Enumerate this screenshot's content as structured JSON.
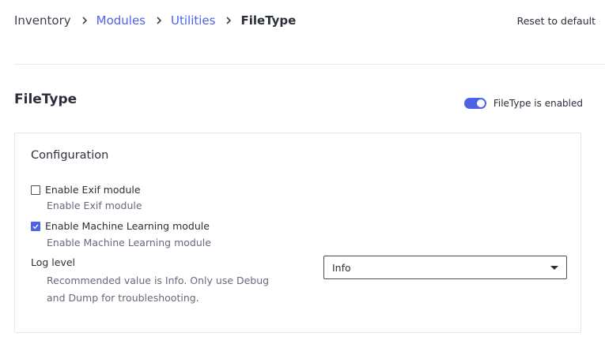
{
  "breadcrumb": {
    "items": [
      {
        "label": "Inventory"
      },
      {
        "label": "Modules"
      },
      {
        "label": "Utilities"
      },
      {
        "label": "FileType"
      }
    ]
  },
  "header": {
    "reset_label": "Reset to default"
  },
  "section": {
    "title": "FileType",
    "toggle_label": "FileType is enabled",
    "toggle_on": true
  },
  "config": {
    "title": "Configuration",
    "options": [
      {
        "label": "Enable Exif module",
        "description": "Enable Exif module",
        "checked": false
      },
      {
        "label": "Enable Machine Learning module",
        "description": "Enable Machine Learning module",
        "checked": true
      }
    ],
    "log_level": {
      "label": "Log level",
      "description": "Recommended value is Info. Only use Debug and Dump for troubleshooting.",
      "selected": "Info"
    }
  },
  "colors": {
    "accent": "#4d63e6",
    "text": "#2a2f3a",
    "muted": "#636b7a",
    "border": "#e3e6ea"
  },
  "icons": {
    "separator": "chevron-right-icon",
    "checkmark": "checkmark-icon",
    "caret": "caret-down-icon"
  }
}
